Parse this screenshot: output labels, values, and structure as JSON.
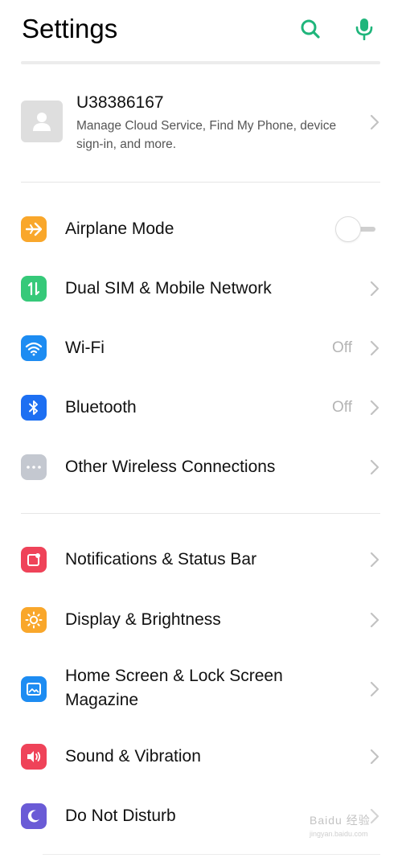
{
  "header": {
    "title": "Settings",
    "search_icon": "search-icon",
    "mic_icon": "mic-icon",
    "accent_color": "#1fb57b"
  },
  "account": {
    "name": "U38386167",
    "description": "Manage Cloud Service, Find My Phone, device sign-in, and more."
  },
  "connectivity": [
    {
      "label": "Airplane Mode",
      "icon": "airplane-icon",
      "icon_color": "#f9a72b",
      "control": "toggle",
      "toggle_on": false
    },
    {
      "label": "Dual SIM & Mobile Network",
      "icon": "mobile-data-icon",
      "icon_color": "#36c979",
      "control": "chevron"
    },
    {
      "label": "Wi-Fi",
      "icon": "wifi-icon",
      "icon_color": "#1d8cf2",
      "control": "chevron",
      "value": "Off"
    },
    {
      "label": "Bluetooth",
      "icon": "bluetooth-icon",
      "icon_color": "#1d6ff2",
      "control": "chevron",
      "value": "Off"
    },
    {
      "label": "Other Wireless Connections",
      "icon": "more-dots-icon",
      "icon_color": "#c4c8d0",
      "control": "chevron"
    }
  ],
  "personalization": [
    {
      "label": "Notifications & Status Bar",
      "icon": "notification-icon",
      "icon_color": "#ef4359"
    },
    {
      "label": "Display & Brightness",
      "icon": "brightness-icon",
      "icon_color": "#f9a72b"
    },
    {
      "label": "Home Screen & Lock Screen Magazine",
      "icon": "wallpaper-icon",
      "icon_color": "#1d8cf2"
    },
    {
      "label": "Sound & Vibration",
      "icon": "speaker-icon",
      "icon_color": "#ef4359"
    },
    {
      "label": "Do Not Disturb",
      "icon": "moon-icon",
      "icon_color": "#6a5bd6"
    }
  ],
  "watermark": {
    "brand": "Baidu 经验",
    "url": "jingyan.baidu.com"
  }
}
